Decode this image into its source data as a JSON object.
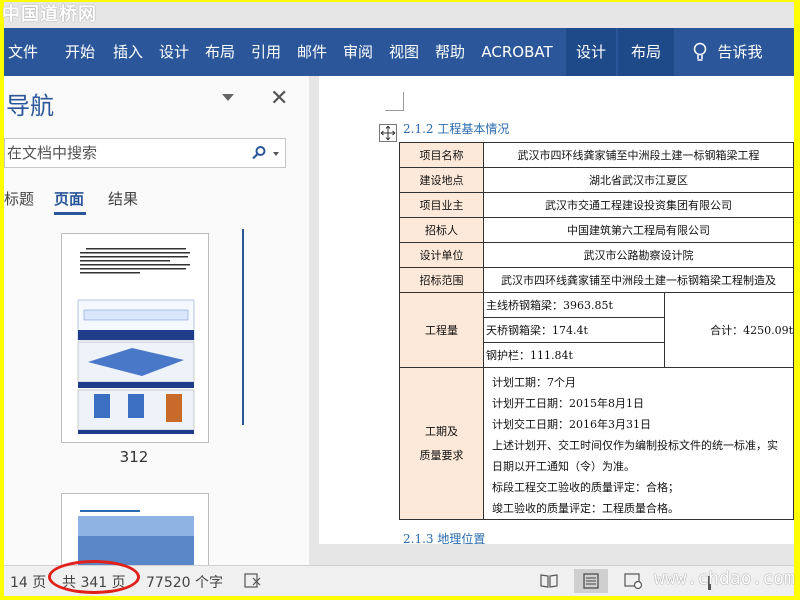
{
  "watermark": "中国道桥网",
  "ribbon": {
    "tabs": [
      "文件",
      "开始",
      "插入",
      "设计",
      "布局",
      "引用",
      "邮件",
      "审阅",
      "视图",
      "帮助",
      "ACROBAT"
    ],
    "context_tabs": [
      "设计",
      "布局"
    ],
    "tell_me": "告诉我"
  },
  "nav": {
    "title": "导航",
    "search_placeholder": "在文档中搜索",
    "tabs": [
      "标题",
      "页面",
      "结果"
    ],
    "active_tab": "页面",
    "thumb_page": "312"
  },
  "doc": {
    "heading1": "2.1.2 工程基本情况",
    "heading2": "2.1.3 地理位置",
    "table": {
      "rows": [
        {
          "label": "项目名称",
          "value": "武汉市四环线龚家铺至中洲段土建一标钢箱梁工程"
        },
        {
          "label": "建设地点",
          "value": "湖北省武汉市江夏区"
        },
        {
          "label": "项目业主",
          "value": "武汉市交通工程建设投资集团有限公司"
        },
        {
          "label": "招标人",
          "value": "中国建筑第六工程局有限公司"
        },
        {
          "label": "设计单位",
          "value": "武汉市公路勘察设计院"
        },
        {
          "label": "招标范围",
          "value": "武汉市四环线龚家铺至中洲段土建一标钢箱梁工程制造及"
        }
      ],
      "quantity_label": "工程量",
      "quantity_items": [
        "主线桥钢箱梁：3963.85t",
        "天桥钢箱梁：174.4t",
        "钢护栏：111.84t"
      ],
      "quantity_total": "合计：4250.09t",
      "schedule_label_1": "工期及",
      "schedule_label_2": "质量要求",
      "schedule_lines": [
        "计划工期：7个月",
        "计划开工日期：2015年8月1日",
        "计划交工日期：2016年3月31日",
        "上述计划开、交工时间仅作为编制投标文件的统一标准，实",
        "日期以开工通知（令）为准。",
        "标段工程交工验收的质量评定：合格；",
        "竣工验收的质量评定：工程质量合格。"
      ]
    }
  },
  "status": {
    "page": "14 页",
    "total": "共 341 页",
    "words": "77520 个字"
  },
  "site_watermark": "www.chdao.com",
  "colors": {
    "ribbon": "#2b579a",
    "label_fill": "#fde9d9",
    "heading": "#2b6cb0",
    "oval": "#e0201b"
  }
}
